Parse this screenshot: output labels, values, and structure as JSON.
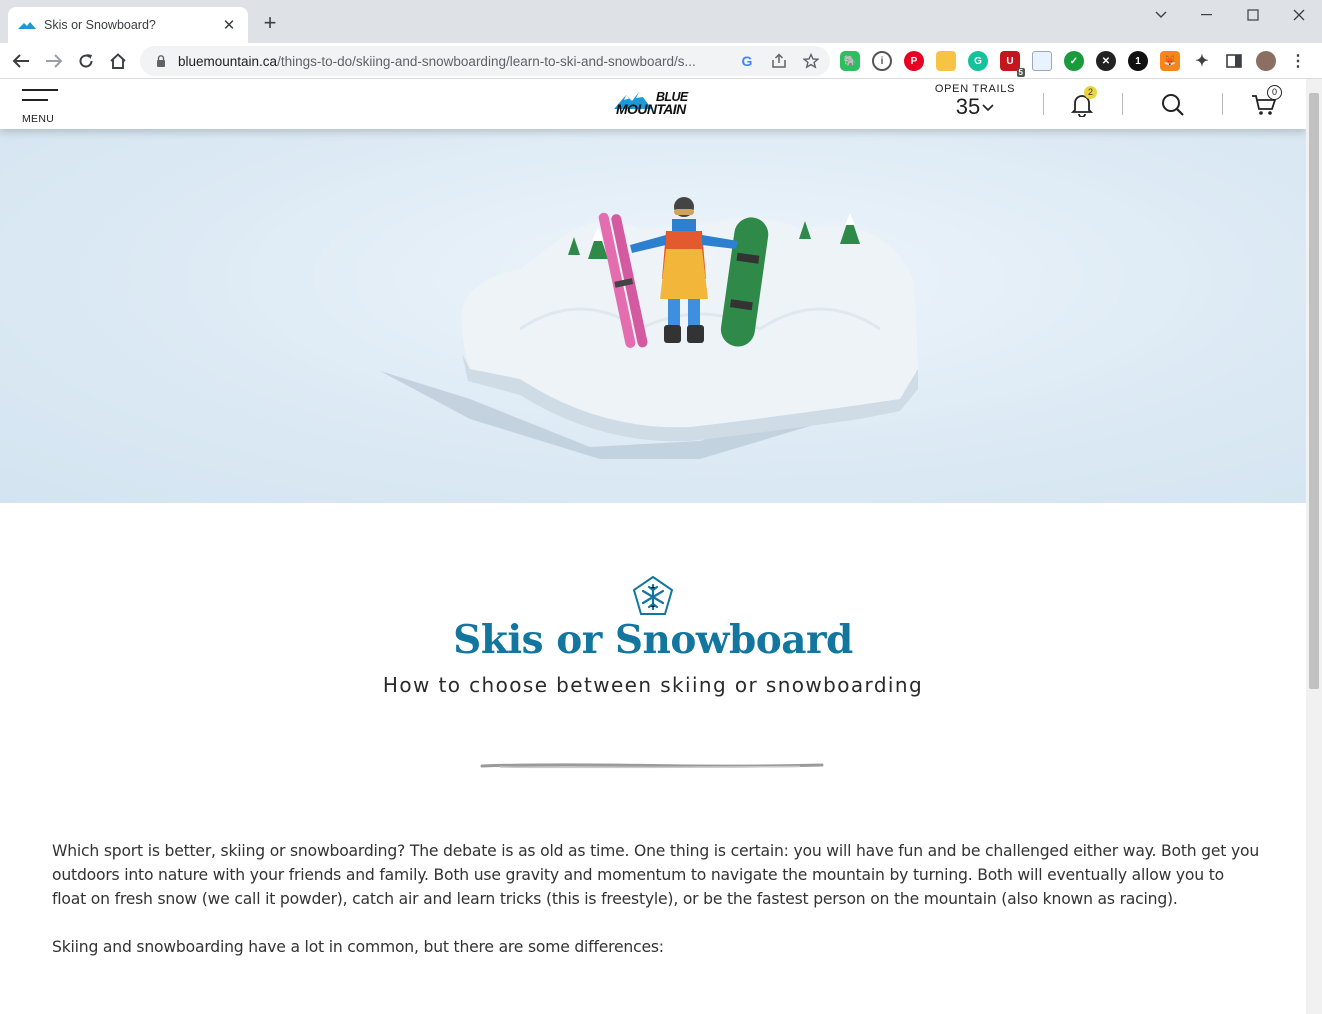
{
  "browser": {
    "tab_title": "Skis or Snowboard?",
    "new_tab_symbol": "+",
    "url_domain": "bluemountain.ca",
    "url_path": "/things-to-do/skiing-and-snowboarding/learn-to-ski-and-snowboard/s...",
    "extension_badge_count": "5"
  },
  "header": {
    "menu_label": "MENU",
    "logo_line1": "BLUE",
    "logo_line2": "MOUNTAIN",
    "open_trails_label": "OPEN TRAILS",
    "open_trails_count": "35",
    "notifications_count": "2",
    "cart_count": "0"
  },
  "article": {
    "title": "Skis or Snowboard",
    "subtitle": "How to choose between skiing or snowboarding",
    "paragraph1": "Which sport is better, skiing or snowboarding? The debate is as old as time. One thing is certain: you will have fun and be challenged either way. Both get you outdoors into nature with your friends and family. Both use gravity and momentum to navigate the mountain by turning. Both will eventually allow you to float on fresh snow (we call it powder), catch air and learn tricks (this is freestyle), or be the fastest person on the mountain (also known as racing).",
    "paragraph2": "Skiing and snowboarding have a lot in common, but there are some differences:"
  },
  "colors": {
    "title_blue": "#13769e",
    "brand_blue": "#1b9ad6",
    "ski_pink": "#e46db0",
    "snowboard_green": "#2f8a4a",
    "notification_badge": "#e8d63a"
  }
}
